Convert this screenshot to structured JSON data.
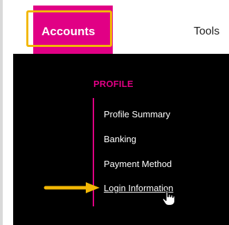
{
  "nav": {
    "accounts_label": "Accounts",
    "tools_label": "Tools"
  },
  "dropdown": {
    "heading": "PROFILE",
    "items": [
      {
        "label": "Profile Summary"
      },
      {
        "label": "Banking"
      },
      {
        "label": "Payment Method"
      },
      {
        "label": "Login Information",
        "active": true
      }
    ]
  },
  "colors": {
    "accent": "#e10085",
    "highlight": "#f2b705",
    "menu_background": "#000000"
  }
}
